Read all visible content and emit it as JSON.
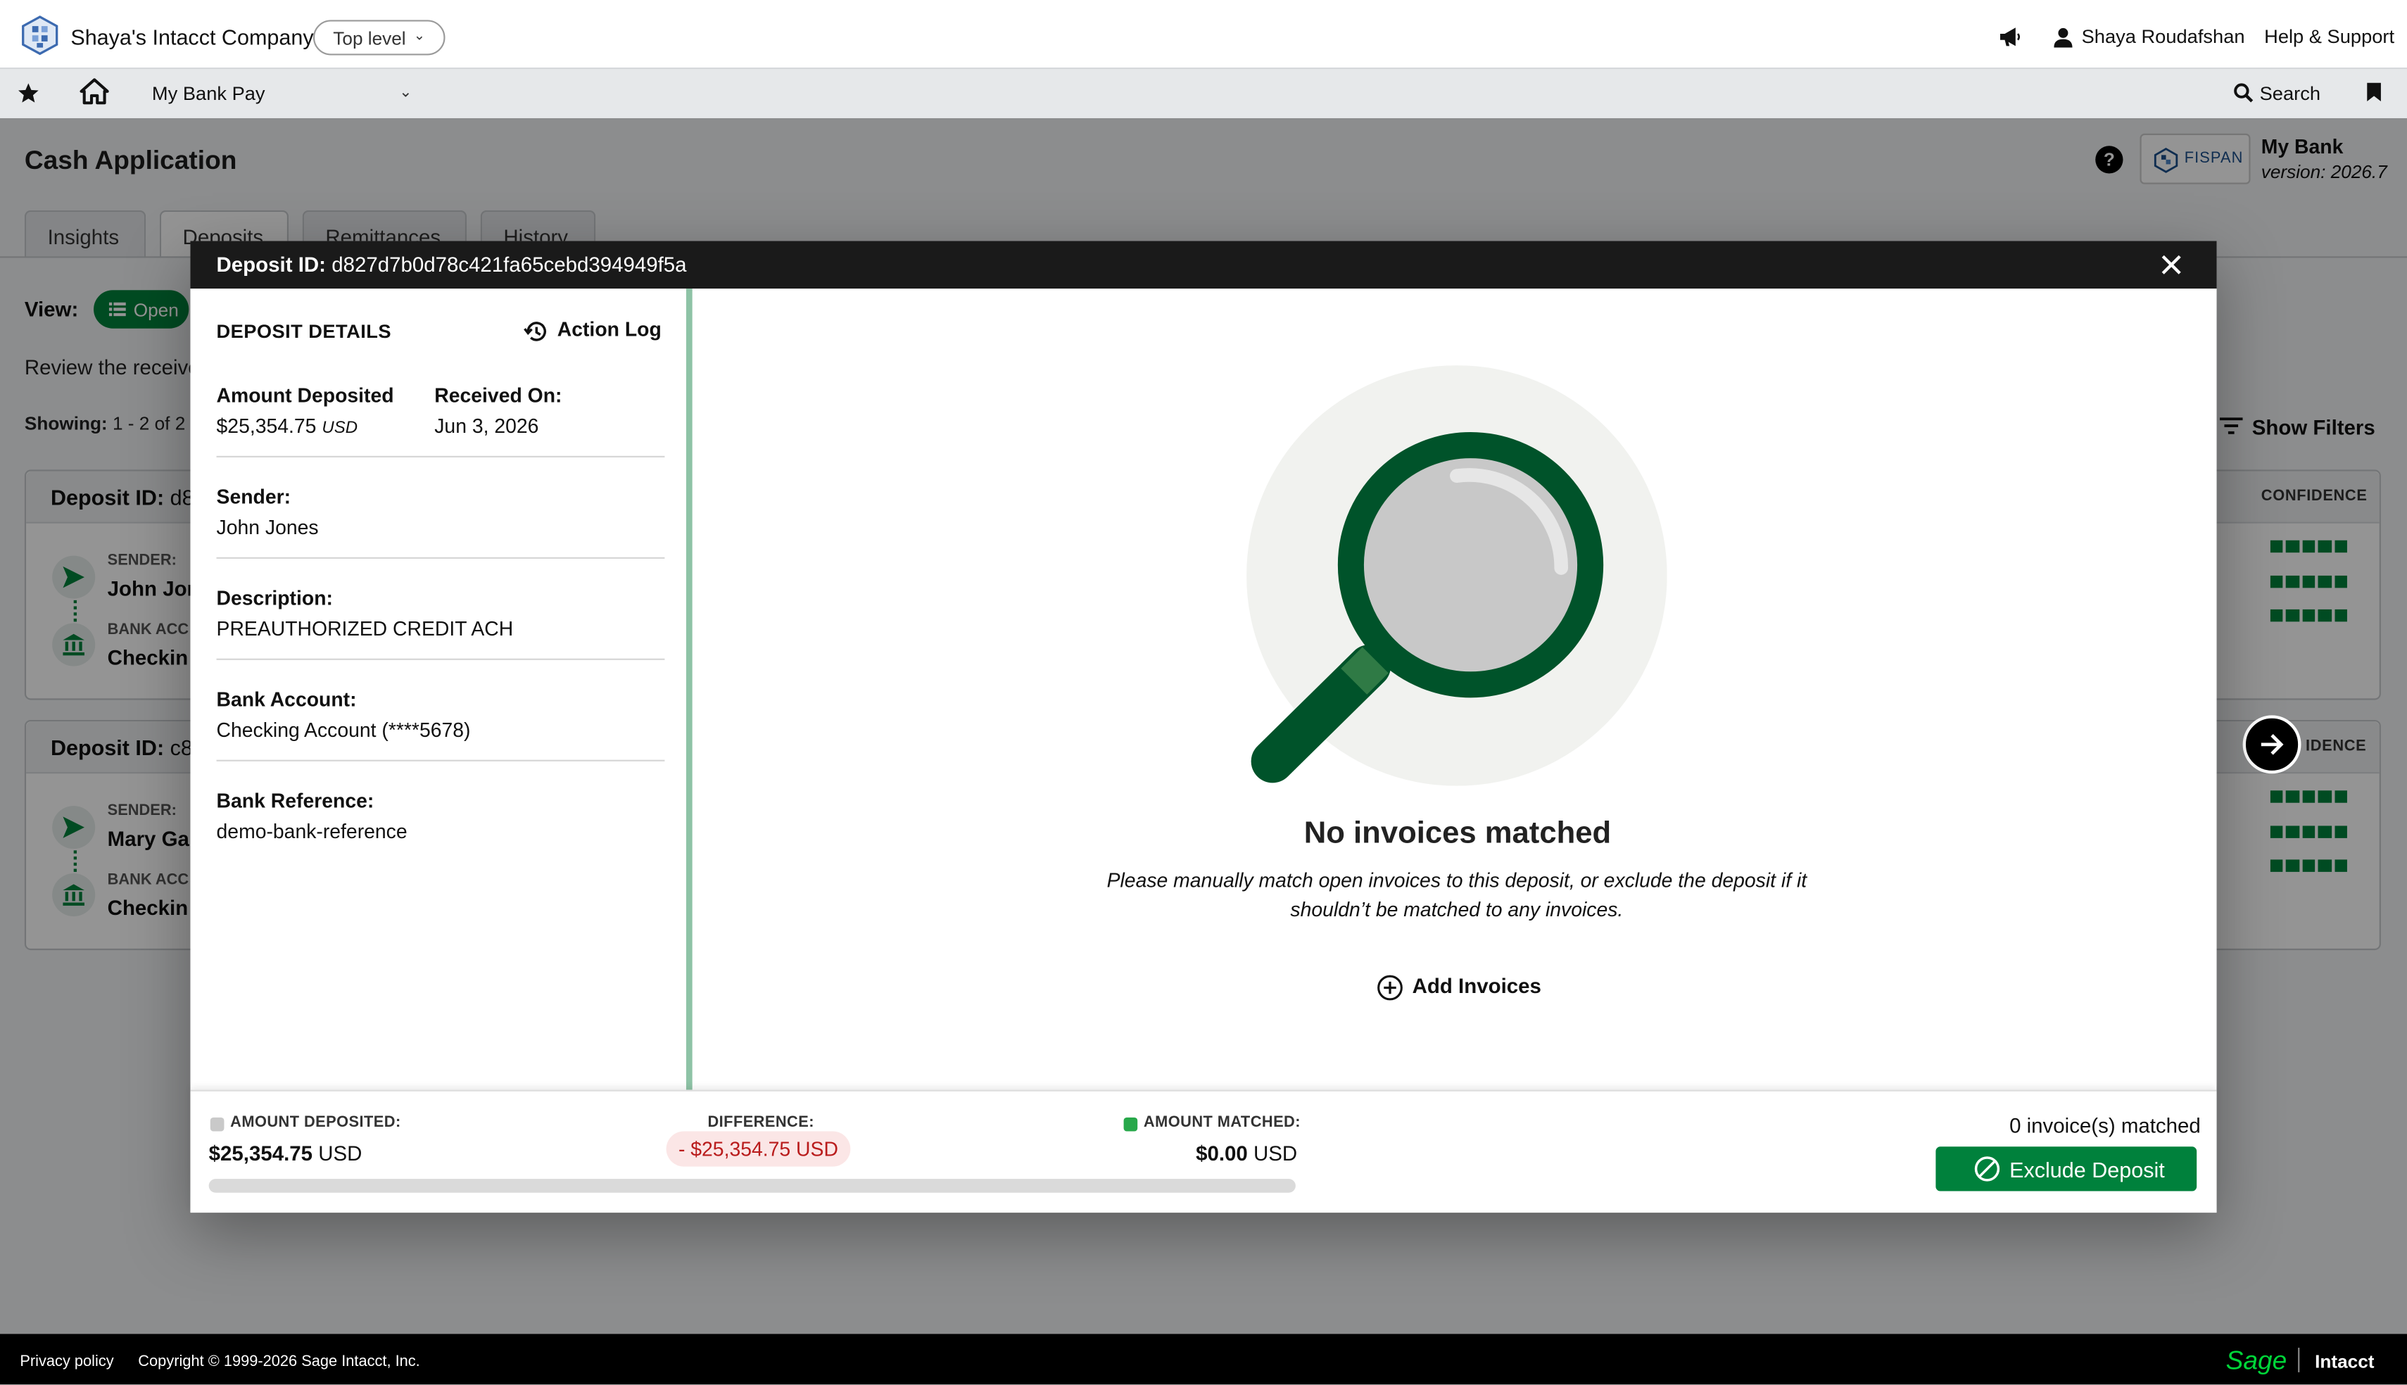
{
  "topbar": {
    "company": "Shaya's Intacct Company",
    "level": "Top level",
    "user": "Shaya Roudafshan",
    "help": "Help & Support"
  },
  "navbar": {
    "app": "My Bank Pay",
    "search": "Search"
  },
  "page": {
    "title": "Cash Application",
    "help_icon": "?",
    "partner_logo_text": "FISPAN",
    "bank_name": "My Bank",
    "version": "version: 2026.7",
    "tabs": [
      "Insights",
      "Deposits",
      "Remittances",
      "History"
    ],
    "view_label": "View:",
    "view_value": "Open",
    "review_text": "Review the receive",
    "showing_label": "Showing:",
    "showing_value": "1 - 2 of 2",
    "show_filters": "Show Filters",
    "cards": [
      {
        "id_label": "Deposit ID:",
        "id_value": "d8",
        "confidence": "CONFIDENCE",
        "sender_label": "SENDER:",
        "sender": "John Jor",
        "bank_label": "BANK ACC",
        "bank": "Checkin"
      },
      {
        "id_label": "Deposit ID:",
        "id_value": "c8",
        "confidence": "IDENCE",
        "sender_label": "SENDER:",
        "sender": "Mary Ga",
        "bank_label": "BANK ACC",
        "bank": "Checkin"
      }
    ]
  },
  "modal": {
    "title_label": "Deposit ID:",
    "title_value": "d827d7b0d78c421fa65cebd394949f5a",
    "details_title": "DEPOSIT DETAILS",
    "action_log": "Action Log",
    "amount_label": "Amount Deposited",
    "amount_value": "$25,354.75",
    "amount_currency": "USD",
    "received_label": "Received On:",
    "received_value": "Jun 3, 2026",
    "sender_label": "Sender:",
    "sender_value": "John Jones",
    "description_label": "Description:",
    "description_value": "PREAUTHORIZED CREDIT ACH",
    "bank_account_label": "Bank Account:",
    "bank_account_value": "Checking Account (****5678)",
    "bank_ref_label": "Bank Reference:",
    "bank_ref_value": "demo-bank-reference",
    "no_invoices_title": "No invoices matched",
    "no_invoices_desc": "Please manually match open invoices to this deposit, or exclude the deposit if it shouldn’t be matched to any invoices.",
    "add_invoices": "Add Invoices"
  },
  "footer_summary": {
    "deposited_label": "AMOUNT DEPOSITED:",
    "deposited_amount": "$25,354.75",
    "deposited_currency": "USD",
    "difference_label": "DIFFERENCE:",
    "difference_value": "- $25,354.75 USD",
    "matched_label": "AMOUNT MATCHED:",
    "matched_amount": "$0.00",
    "matched_currency": "USD",
    "matched_fraction": 0,
    "matched_count": "0 invoice(s) matched",
    "exclude_button": "Exclude Deposit"
  },
  "footer": {
    "privacy": "Privacy policy",
    "copyright": "Copyright © 1999-2026 Sage Intacct, Inc.",
    "brand_sage": "Sage",
    "brand_intacct": "Intacct"
  },
  "colors": {
    "brand_green": "#00813c",
    "difference_red": "#b91c1c",
    "header_dark": "#1a1a1a"
  },
  "icons": [
    "company-logo",
    "chevron-down-icon",
    "megaphone-icon",
    "user-icon",
    "star-icon",
    "home-icon",
    "search-icon",
    "bookmark-icon",
    "help-icon",
    "close-icon",
    "history-icon",
    "magnifier-illustration",
    "plus-circle-icon",
    "block-icon",
    "arrow-right-icon",
    "send-icon",
    "bank-icon",
    "list-icon",
    "filter-icon"
  ]
}
